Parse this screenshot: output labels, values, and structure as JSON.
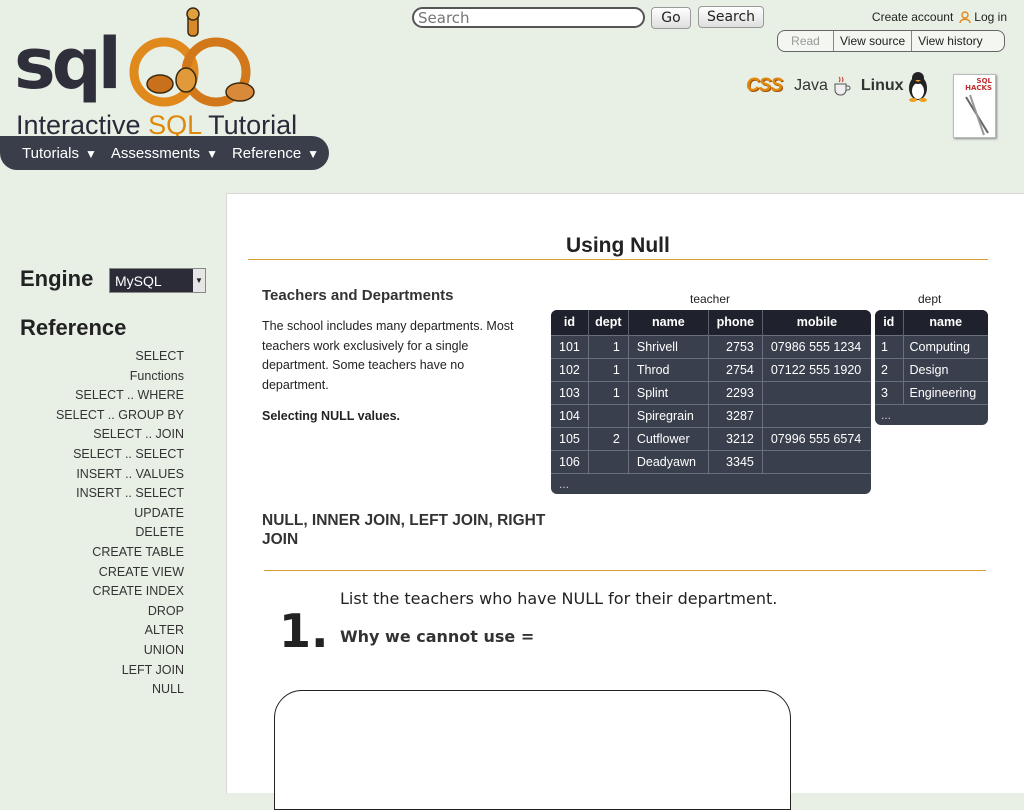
{
  "header": {
    "logo_text": "sqlzoo",
    "subtitle_pre": "Interactive ",
    "subtitle_hl": "SQL",
    "subtitle_post": " Tutorial",
    "nav": [
      {
        "label": "Tutorials"
      },
      {
        "label": "Assessments"
      },
      {
        "label": "Reference"
      }
    ],
    "search": {
      "placeholder": "Search",
      "go_label": "Go",
      "search_label": "Search"
    },
    "create_account": "Create account",
    "log_in": "Log in",
    "tabs": [
      "Read",
      "View source",
      "View history"
    ],
    "tech": {
      "css": "CSS",
      "java": "Java",
      "linux": "Linux"
    },
    "book_title": "SQL HACKS"
  },
  "sidebar": {
    "engine_label": "Engine",
    "engine_value": "MySQL",
    "reference_heading": "Reference",
    "items": [
      "SELECT",
      "Functions",
      "SELECT .. WHERE",
      "SELECT .. GROUP BY",
      "SELECT .. JOIN",
      "SELECT .. SELECT",
      "INSERT .. VALUES",
      "INSERT .. SELECT",
      "UPDATE",
      "DELETE",
      "CREATE TABLE",
      "CREATE VIEW",
      "CREATE INDEX",
      "DROP",
      "ALTER",
      "UNION",
      "LEFT JOIN",
      "NULL"
    ]
  },
  "main": {
    "title": "Using Null",
    "section_title": "Teachers and Departments",
    "paragraph": "The school includes many departments. Most teachers work exclusively for a single department. Some teachers have no department.",
    "bold_para": "Selecting NULL values.",
    "section2": "NULL, INNER JOIN, LEFT JOIN, RIGHT JOIN",
    "question_number": "1.",
    "question_text": "List the teachers who have NULL for their department.",
    "question_sub": "Why we cannot use ="
  },
  "teacher_table": {
    "caption": "teacher",
    "columns": [
      "id",
      "dept",
      "name",
      "phone",
      "mobile"
    ],
    "rows": [
      [
        "101",
        "1",
        "Shrivell",
        "2753",
        "07986 555 1234"
      ],
      [
        "102",
        "1",
        "Throd",
        "2754",
        "07122 555 1920"
      ],
      [
        "103",
        "1",
        "Splint",
        "2293",
        ""
      ],
      [
        "104",
        "",
        "Spiregrain",
        "3287",
        ""
      ],
      [
        "105",
        "2",
        "Cutflower",
        "3212",
        "07996 555 6574"
      ],
      [
        "106",
        "",
        "Deadyawn",
        "3345",
        ""
      ]
    ],
    "more": "..."
  },
  "dept_table": {
    "caption": "dept",
    "columns": [
      "id",
      "name"
    ],
    "rows": [
      [
        "1",
        "Computing"
      ],
      [
        "2",
        "Design"
      ],
      [
        "3",
        "Engineering"
      ]
    ],
    "more": "..."
  }
}
